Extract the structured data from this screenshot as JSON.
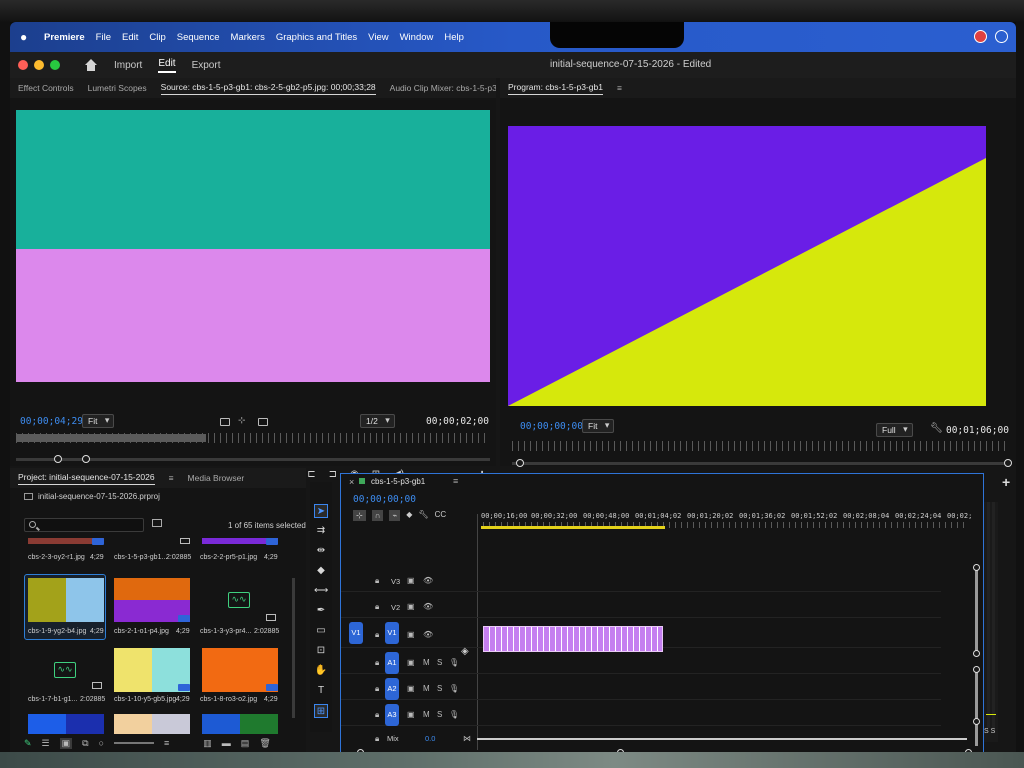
{
  "menubar": {
    "app": "Premiere",
    "items": [
      "File",
      "Edit",
      "Clip",
      "Sequence",
      "Markers",
      "Graphics and Titles",
      "View",
      "Window",
      "Help"
    ]
  },
  "titlebar": {
    "workspaces": [
      "Import",
      "Edit",
      "Export"
    ],
    "active_workspace": "Edit",
    "document_title": "initial-sequence-07-15-2026 - Edited"
  },
  "source_panel": {
    "tabs": [
      "Effect Controls",
      "Lumetri Scopes",
      "Source: cbs-1-5-p3-gb1: cbs-2-5-gb2-p5.jpg: 00;00;33;28",
      "Audio Clip Mixer: cbs-1-5-p3-gb1"
    ],
    "active_tab_index": 2,
    "timecode_left": "00;00;04;29",
    "fit": "Fit",
    "resolution": "1/2",
    "timecode_right": "00;00;02;00",
    "colors": {
      "top": "#18b09b",
      "bottom": "#dc88ec"
    }
  },
  "program_panel": {
    "tab": "Program: cbs-1-5-p3-gb1",
    "timecode_left": "00;00;00;00",
    "fit": "Fit",
    "resolution": "Full",
    "timecode_right": "00;01;06;00",
    "colors": {
      "purple": "#6a1ee6",
      "yellow": "#d6e80c"
    }
  },
  "project_panel": {
    "tabs": [
      "Project: initial-sequence-07-15-2026",
      "Media Browser"
    ],
    "project_file": "initial-sequence-07-15-2026.prproj",
    "items_selected": "1 of 65 items selected",
    "items": [
      {
        "name": "cbs-2-3-oy2-r1.jpg",
        "duration": "4;29"
      },
      {
        "name": "cbs-1-5-p3-gb1...",
        "duration": "2:02885"
      },
      {
        "name": "cbs-2-2-pr5-p1.jpg",
        "duration": "4;29"
      },
      {
        "name": "cbs-1-9-yg2-b4.jpg",
        "duration": "4;29"
      },
      {
        "name": "cbs-2-1-o1-p4.jpg",
        "duration": "4;29"
      },
      {
        "name": "cbs-1-3-y3-pr4...",
        "duration": "2:02885"
      },
      {
        "name": "cbs-1-7-b1-g1...",
        "duration": "2:02885"
      },
      {
        "name": "cbs-1-10-y5-gb5.jpg",
        "duration": "4;29"
      },
      {
        "name": "cbs-1-8-ro3-o2.jpg",
        "duration": "4;29"
      }
    ]
  },
  "timeline": {
    "sequence_tab": "cbs-1-5-p3-gb1",
    "timecode": "00;00;00;00",
    "ruler": [
      "00;00;16;00",
      "00;00;32;00",
      "00;00;48;00",
      "00;01;04;02",
      "00;01;20;02",
      "00;01;36;02",
      "00;01;52;02",
      "00;02;08;04",
      "00;02;24;04",
      "00;02;"
    ],
    "video_tracks": [
      "V3",
      "V2",
      "V1"
    ],
    "audio_tracks": [
      "A1",
      "A2",
      "A3"
    ],
    "source_target_v": "V1",
    "mix_label": "Mix",
    "mix_value": "0.0",
    "audio_track_letters": {
      "mute": "M",
      "solo": "S"
    }
  },
  "meter": {
    "labels": "S S"
  }
}
